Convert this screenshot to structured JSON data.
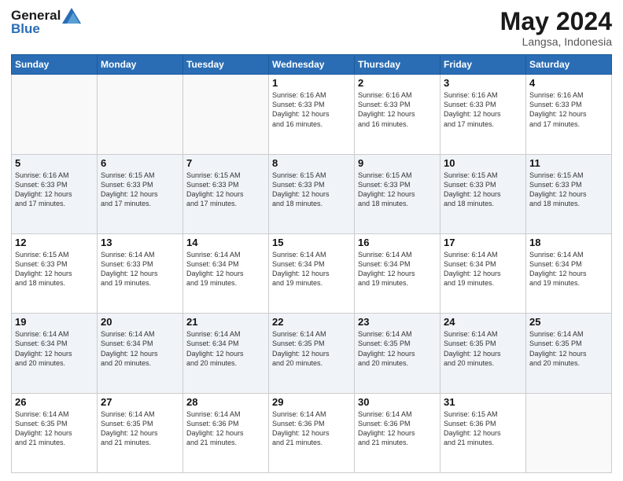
{
  "header": {
    "logo_line1": "General",
    "logo_line2": "Blue",
    "month_year": "May 2024",
    "location": "Langsa, Indonesia"
  },
  "days_of_week": [
    "Sunday",
    "Monday",
    "Tuesday",
    "Wednesday",
    "Thursday",
    "Friday",
    "Saturday"
  ],
  "weeks": [
    {
      "shaded": false,
      "days": [
        {
          "number": "",
          "info": ""
        },
        {
          "number": "",
          "info": ""
        },
        {
          "number": "",
          "info": ""
        },
        {
          "number": "1",
          "info": "Sunrise: 6:16 AM\nSunset: 6:33 PM\nDaylight: 12 hours\nand 16 minutes."
        },
        {
          "number": "2",
          "info": "Sunrise: 6:16 AM\nSunset: 6:33 PM\nDaylight: 12 hours\nand 16 minutes."
        },
        {
          "number": "3",
          "info": "Sunrise: 6:16 AM\nSunset: 6:33 PM\nDaylight: 12 hours\nand 17 minutes."
        },
        {
          "number": "4",
          "info": "Sunrise: 6:16 AM\nSunset: 6:33 PM\nDaylight: 12 hours\nand 17 minutes."
        }
      ]
    },
    {
      "shaded": true,
      "days": [
        {
          "number": "5",
          "info": "Sunrise: 6:16 AM\nSunset: 6:33 PM\nDaylight: 12 hours\nand 17 minutes."
        },
        {
          "number": "6",
          "info": "Sunrise: 6:15 AM\nSunset: 6:33 PM\nDaylight: 12 hours\nand 17 minutes."
        },
        {
          "number": "7",
          "info": "Sunrise: 6:15 AM\nSunset: 6:33 PM\nDaylight: 12 hours\nand 17 minutes."
        },
        {
          "number": "8",
          "info": "Sunrise: 6:15 AM\nSunset: 6:33 PM\nDaylight: 12 hours\nand 18 minutes."
        },
        {
          "number": "9",
          "info": "Sunrise: 6:15 AM\nSunset: 6:33 PM\nDaylight: 12 hours\nand 18 minutes."
        },
        {
          "number": "10",
          "info": "Sunrise: 6:15 AM\nSunset: 6:33 PM\nDaylight: 12 hours\nand 18 minutes."
        },
        {
          "number": "11",
          "info": "Sunrise: 6:15 AM\nSunset: 6:33 PM\nDaylight: 12 hours\nand 18 minutes."
        }
      ]
    },
    {
      "shaded": false,
      "days": [
        {
          "number": "12",
          "info": "Sunrise: 6:15 AM\nSunset: 6:33 PM\nDaylight: 12 hours\nand 18 minutes."
        },
        {
          "number": "13",
          "info": "Sunrise: 6:14 AM\nSunset: 6:33 PM\nDaylight: 12 hours\nand 19 minutes."
        },
        {
          "number": "14",
          "info": "Sunrise: 6:14 AM\nSunset: 6:34 PM\nDaylight: 12 hours\nand 19 minutes."
        },
        {
          "number": "15",
          "info": "Sunrise: 6:14 AM\nSunset: 6:34 PM\nDaylight: 12 hours\nand 19 minutes."
        },
        {
          "number": "16",
          "info": "Sunrise: 6:14 AM\nSunset: 6:34 PM\nDaylight: 12 hours\nand 19 minutes."
        },
        {
          "number": "17",
          "info": "Sunrise: 6:14 AM\nSunset: 6:34 PM\nDaylight: 12 hours\nand 19 minutes."
        },
        {
          "number": "18",
          "info": "Sunrise: 6:14 AM\nSunset: 6:34 PM\nDaylight: 12 hours\nand 19 minutes."
        }
      ]
    },
    {
      "shaded": true,
      "days": [
        {
          "number": "19",
          "info": "Sunrise: 6:14 AM\nSunset: 6:34 PM\nDaylight: 12 hours\nand 20 minutes."
        },
        {
          "number": "20",
          "info": "Sunrise: 6:14 AM\nSunset: 6:34 PM\nDaylight: 12 hours\nand 20 minutes."
        },
        {
          "number": "21",
          "info": "Sunrise: 6:14 AM\nSunset: 6:34 PM\nDaylight: 12 hours\nand 20 minutes."
        },
        {
          "number": "22",
          "info": "Sunrise: 6:14 AM\nSunset: 6:35 PM\nDaylight: 12 hours\nand 20 minutes."
        },
        {
          "number": "23",
          "info": "Sunrise: 6:14 AM\nSunset: 6:35 PM\nDaylight: 12 hours\nand 20 minutes."
        },
        {
          "number": "24",
          "info": "Sunrise: 6:14 AM\nSunset: 6:35 PM\nDaylight: 12 hours\nand 20 minutes."
        },
        {
          "number": "25",
          "info": "Sunrise: 6:14 AM\nSunset: 6:35 PM\nDaylight: 12 hours\nand 20 minutes."
        }
      ]
    },
    {
      "shaded": false,
      "days": [
        {
          "number": "26",
          "info": "Sunrise: 6:14 AM\nSunset: 6:35 PM\nDaylight: 12 hours\nand 21 minutes."
        },
        {
          "number": "27",
          "info": "Sunrise: 6:14 AM\nSunset: 6:35 PM\nDaylight: 12 hours\nand 21 minutes."
        },
        {
          "number": "28",
          "info": "Sunrise: 6:14 AM\nSunset: 6:36 PM\nDaylight: 12 hours\nand 21 minutes."
        },
        {
          "number": "29",
          "info": "Sunrise: 6:14 AM\nSunset: 6:36 PM\nDaylight: 12 hours\nand 21 minutes."
        },
        {
          "number": "30",
          "info": "Sunrise: 6:14 AM\nSunset: 6:36 PM\nDaylight: 12 hours\nand 21 minutes."
        },
        {
          "number": "31",
          "info": "Sunrise: 6:15 AM\nSunset: 6:36 PM\nDaylight: 12 hours\nand 21 minutes."
        },
        {
          "number": "",
          "info": ""
        }
      ]
    }
  ]
}
